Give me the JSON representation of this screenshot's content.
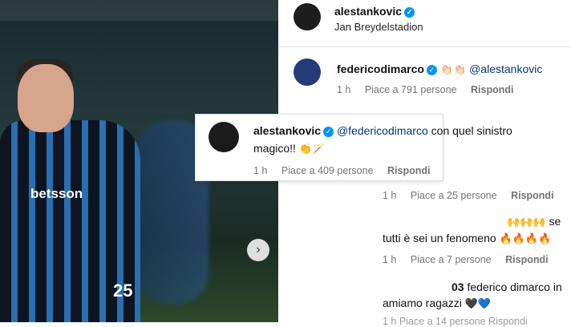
{
  "photo": {
    "sponsor": "betsson",
    "shirt_number": "25",
    "next_icon": "chevron-right-icon"
  },
  "header": {
    "username": "alestankovic",
    "location": "Jan Breydelstadion"
  },
  "comments": [
    {
      "username": "federicodimarco",
      "emoji": "👏🏻👏🏻",
      "mention": "@alestankovic",
      "time": "1 h",
      "likes": "Piace a 791 persone",
      "reply": "Rispondi"
    },
    {
      "time": "1 h",
      "likes": "Piace a 25 persone",
      "reply": "Rispondi"
    },
    {
      "line1_emoji": "🙌🙌🙌",
      "line1_tail": "se",
      "line2": "tutti è sei un fenomeno",
      "line2_emoji": "🔥🔥🔥🔥",
      "time": "1 h",
      "likes": "Piace a 7 persone",
      "reply": "Rispondi"
    },
    {
      "line1_prefix": "03",
      "line1": "federico dimarco in",
      "line2": "amiamo ragazzi",
      "line2_emoji": "🖤💙",
      "partial_meta": "1 h   Piace a 14 persone   Rispondi"
    }
  ],
  "highlight": {
    "username": "alestankovic",
    "mention": "@federicodimarco",
    "text1": "con quel sinistro",
    "text2": "magico!!",
    "emoji": "👏🪄",
    "time": "1 h",
    "likes": "Piace a 409 persone",
    "reply": "Rispondi"
  },
  "colors": {
    "verified": "#0095f6",
    "mention": "#00376b",
    "meta": "#737373"
  }
}
